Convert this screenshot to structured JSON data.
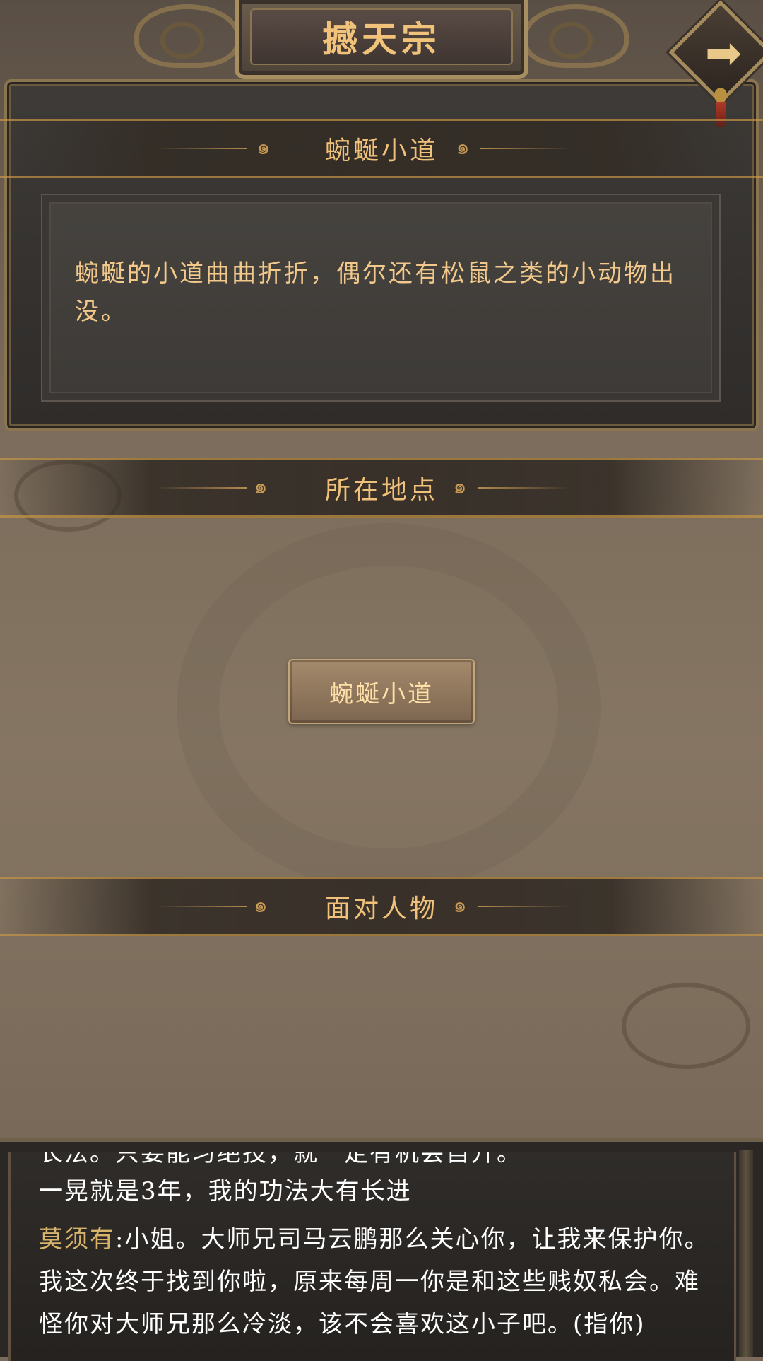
{
  "sect_title": "撼天宗",
  "scene": {
    "header": "蜿蜒小道",
    "description": "蜿蜒的小道曲曲折折，偶尔还有松鼠之类的小动物出没。"
  },
  "location_section": {
    "header": "所在地点",
    "buttons": [
      "蜿蜒小道"
    ]
  },
  "people_section": {
    "header": "面对人物"
  },
  "log": {
    "partial_line": "长法。只要能习绝技，就一定有机会自升。",
    "line1": "一晃就是3年，我的功法大有长进",
    "speaker": "莫须有",
    "speech_part1": ":小姐。大师兄司马云鹏那么关心你，让我来保护你。",
    "speech_part2": "我这次终于找到你啦，原来每周一你是和这些贱奴私会。难",
    "speech_part3": "怪你对大师兄那么冷淡，该不会喜欢这小子吧。(指你)"
  },
  "icons": {
    "exit": "arrow-right-icon",
    "ornament": "swirl-icon"
  },
  "colors": {
    "gold_text": "#efc17a",
    "panel_dark": "#34312f",
    "speaker": "#d8b36a"
  }
}
